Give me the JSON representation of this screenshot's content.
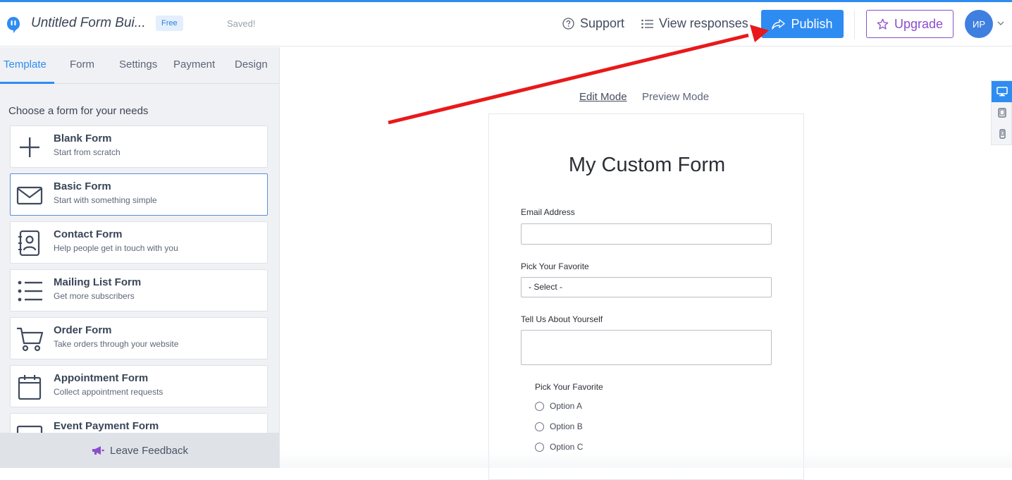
{
  "header": {
    "app_title": "Untitled Form Bui...",
    "plan_badge": "Free",
    "save_status": "Saved!",
    "support_label": "Support",
    "view_responses_label": "View responses",
    "publish_label": "Publish",
    "upgrade_label": "Upgrade",
    "avatar_initials": "ИР"
  },
  "sidebar": {
    "tabs": [
      {
        "label": "Template",
        "active": true
      },
      {
        "label": "Form",
        "active": false
      },
      {
        "label": "Settings",
        "active": false
      },
      {
        "label": "Payment",
        "active": false
      },
      {
        "label": "Design",
        "active": false
      }
    ],
    "heading": "Choose a form for your needs",
    "templates": [
      {
        "title": "Blank Form",
        "subtitle": "Start from scratch",
        "icon": "plus-icon"
      },
      {
        "title": "Basic Form",
        "subtitle": "Start with something simple",
        "icon": "envelope-icon",
        "selected": true
      },
      {
        "title": "Contact Form",
        "subtitle": "Help people get in touch with you",
        "icon": "contact-book-icon"
      },
      {
        "title": "Mailing List Form",
        "subtitle": "Get more subscribers",
        "icon": "list-icon"
      },
      {
        "title": "Order Form",
        "subtitle": "Take orders through your website",
        "icon": "cart-icon"
      },
      {
        "title": "Appointment Form",
        "subtitle": "Collect appointment requests",
        "icon": "calendar-icon"
      },
      {
        "title": "Event Payment Form",
        "subtitle": "",
        "icon": "card-icon"
      }
    ],
    "feedback_label": "Leave Feedback"
  },
  "canvas": {
    "edit_mode_label": "Edit Mode",
    "preview_mode_label": "Preview Mode",
    "device_buttons": [
      "desktop-icon",
      "tablet-icon",
      "phone-icon"
    ]
  },
  "form": {
    "title": "My Custom Form",
    "email_label": "Email Address",
    "email_value": "",
    "pick_label": "Pick Your Favorite",
    "select_value": "- Select -",
    "about_label": "Tell Us About Yourself",
    "about_value": "",
    "radio_label": "Pick Your Favorite",
    "radio_options": [
      "Option A",
      "Option B",
      "Option C"
    ]
  },
  "colors": {
    "accent": "#2f8cf0",
    "upgrade": "#8a4ecb",
    "annotation_arrow": "#e8191a"
  }
}
